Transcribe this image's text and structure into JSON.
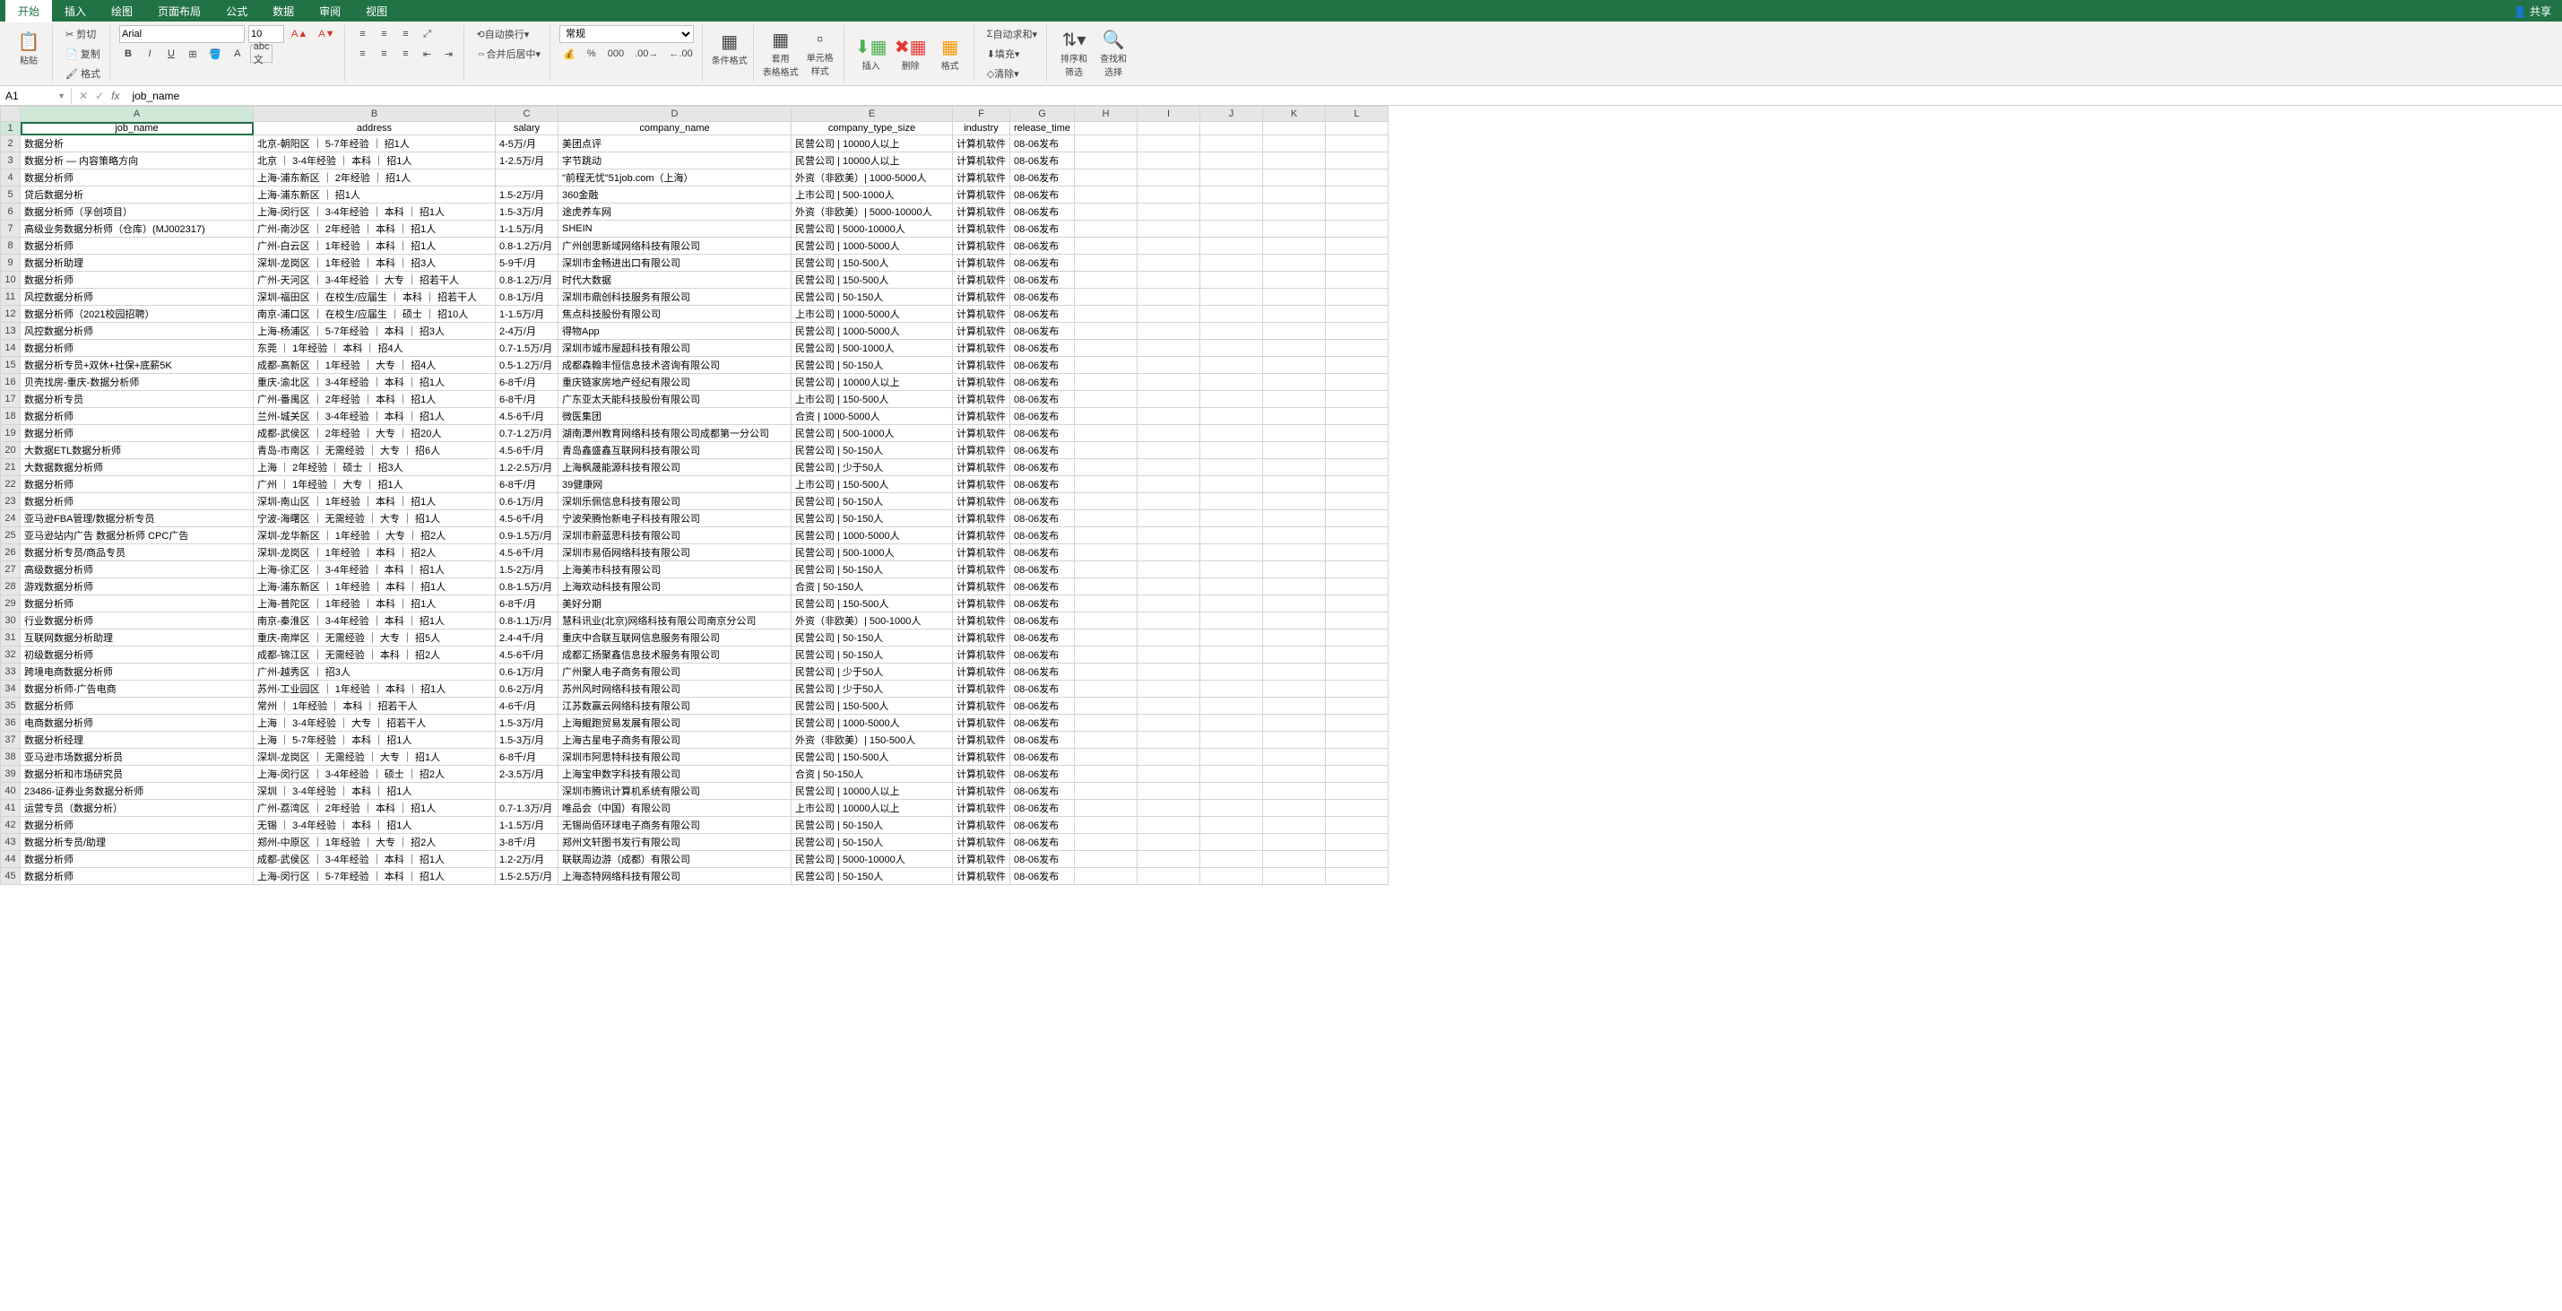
{
  "tabs": {
    "t0": "开始",
    "t1": "插入",
    "t2": "绘图",
    "t3": "页面布局",
    "t4": "公式",
    "t5": "数据",
    "t6": "审阅",
    "t7": "视图",
    "share": "共享"
  },
  "ribbon": {
    "paste_label": "粘贴",
    "cut": "剪切",
    "copy": "复制",
    "format": "格式",
    "font_name": "Arial",
    "font_size": "10",
    "wrap": "自动换行",
    "merge": "合并后居中",
    "number_format": "常规",
    "cond_fmt": "条件格式",
    "table_fmt": "套用\n表格格式",
    "cell_style": "单元格\n样式",
    "insert": "插入",
    "delete": "删除",
    "fmt": "格式",
    "autosum": "自动求和",
    "fill": "填充",
    "clear": "清除",
    "sort": "排序和\n筛选",
    "find": "查找和\n选择"
  },
  "namebox": "A1",
  "formula": "job_name",
  "cols": [
    "A",
    "B",
    "C",
    "D",
    "E",
    "F",
    "G",
    "H",
    "I",
    "J",
    "K",
    "L"
  ],
  "headers": {
    "A": "job_name",
    "B": "address",
    "C": "salary",
    "D": "company_name",
    "E": "company_type_size",
    "F": "industry",
    "G": "release_time"
  },
  "rows": [
    {
      "A": "数据分析",
      "B": "北京-朝阳区 ｜ 5-7年经验 ｜ 招1人",
      "C": "4-5万/月",
      "D": "美团点评",
      "E": "民营公司 | 10000人以上",
      "F": "计算机软件",
      "G": "08-06发布"
    },
    {
      "A": "数据分析 — 内容策略方向",
      "B": "北京 ｜ 3-4年经验 ｜ 本科 ｜ 招1人",
      "C": "1-2.5万/月",
      "D": "字节跳动",
      "E": "民营公司 | 10000人以上",
      "F": "计算机软件",
      "G": "08-06发布"
    },
    {
      "A": "数据分析师",
      "B": "上海-浦东新区 ｜ 2年经验 ｜ 招1人",
      "C": "",
      "D": "\"前程无忧\"51job.com（上海）",
      "E": "外资（非欧美）| 1000-5000人",
      "F": "计算机软件",
      "G": "08-06发布"
    },
    {
      "A": "贷后数据分析",
      "B": "上海-浦东新区 ｜ 招1人",
      "C": "1.5-2万/月",
      "D": "360金融",
      "E": "上市公司 | 500-1000人",
      "F": "计算机软件",
      "G": "08-06发布"
    },
    {
      "A": "数据分析师（孚创项目）",
      "B": "上海-闵行区 ｜ 3-4年经验 ｜ 本科 ｜ 招1人",
      "C": "1.5-3万/月",
      "D": "途虎养车网",
      "E": "外资（非欧美）| 5000-10000人",
      "F": "计算机软件",
      "G": "08-06发布"
    },
    {
      "A": "高级业务数据分析师（仓库）(MJ002317)",
      "B": "广州-南沙区 ｜ 2年经验 ｜ 本科 ｜ 招1人",
      "C": "1-1.5万/月",
      "D": "SHEIN",
      "E": "民营公司 | 5000-10000人",
      "F": "计算机软件",
      "G": "08-06发布"
    },
    {
      "A": "数据分析师",
      "B": "广州-白云区 ｜ 1年经验 ｜ 本科 ｜ 招1人",
      "C": "0.8-1.2万/月",
      "D": "广州创思新域网络科技有限公司",
      "E": "民营公司 | 1000-5000人",
      "F": "计算机软件",
      "G": "08-06发布"
    },
    {
      "A": "数据分析助理",
      "B": "深圳-龙岗区 ｜ 1年经验 ｜ 本科 ｜ 招3人",
      "C": "5-9千/月",
      "D": "深圳市金畅进出口有限公司",
      "E": "民营公司 | 150-500人",
      "F": "计算机软件",
      "G": "08-06发布"
    },
    {
      "A": "数据分析师",
      "B": "广州-天河区 ｜ 3-4年经验 ｜ 大专 ｜ 招若干人",
      "C": "0.8-1.2万/月",
      "D": "时代大数据",
      "E": "民营公司 | 150-500人",
      "F": "计算机软件",
      "G": "08-06发布"
    },
    {
      "A": "风控数据分析师",
      "B": "深圳-福田区 ｜ 在校生/应届生 ｜ 本科 ｜ 招若干人",
      "C": "0.8-1万/月",
      "D": "深圳市鼎创科技服务有限公司",
      "E": "民营公司 | 50-150人",
      "F": "计算机软件",
      "G": "08-06发布"
    },
    {
      "A": "数据分析师（2021校园招聘）",
      "B": "南京-浦口区 ｜ 在校生/应届生 ｜ 硕士 ｜ 招10人",
      "C": "1-1.5万/月",
      "D": "焦点科技股份有限公司",
      "E": "上市公司 | 1000-5000人",
      "F": "计算机软件",
      "G": "08-06发布"
    },
    {
      "A": "风控数据分析师",
      "B": "上海-杨浦区 ｜ 5-7年经验 ｜ 本科 ｜ 招3人",
      "C": "2-4万/月",
      "D": "得物App",
      "E": "民营公司 | 1000-5000人",
      "F": "计算机软件",
      "G": "08-06发布"
    },
    {
      "A": "数据分析师",
      "B": "东莞 ｜ 1年经验 ｜ 本科 ｜ 招4人",
      "C": "0.7-1.5万/月",
      "D": "深圳市城市屋超科技有限公司",
      "E": "民营公司 | 500-1000人",
      "F": "计算机软件",
      "G": "08-06发布"
    },
    {
      "A": "数据分析专员+双休+社保+底薪5K",
      "B": "成都-高新区 ｜ 1年经验 ｜ 大专 ｜ 招4人",
      "C": "0.5-1.2万/月",
      "D": "成都森翰丰恒信息技术咨询有限公司",
      "E": "民营公司 | 50-150人",
      "F": "计算机软件",
      "G": "08-06发布"
    },
    {
      "A": "贝壳找房-重庆-数据分析师",
      "B": "重庆-渝北区 ｜ 3-4年经验 ｜ 本科 ｜ 招1人",
      "C": "6-8千/月",
      "D": "重庆链家房地产经纪有限公司",
      "E": "民营公司 | 10000人以上",
      "F": "计算机软件",
      "G": "08-06发布"
    },
    {
      "A": "数据分析专员",
      "B": "广州-番禺区 ｜ 2年经验 ｜ 本科 ｜ 招1人",
      "C": "6-8千/月",
      "D": "广东亚太天能科技股份有限公司",
      "E": "上市公司 | 150-500人",
      "F": "计算机软件",
      "G": "08-06发布"
    },
    {
      "A": "数据分析师",
      "B": "兰州-城关区 ｜ 3-4年经验 ｜ 本科 ｜ 招1人",
      "C": "4.5-6千/月",
      "D": "微医集团",
      "E": "合资 | 1000-5000人",
      "F": "计算机软件",
      "G": "08-06发布"
    },
    {
      "A": "数据分析师",
      "B": "成都-武侯区 ｜ 2年经验 ｜ 大专 ｜ 招20人",
      "C": "0.7-1.2万/月",
      "D": "湖南潭州教育网络科技有限公司成都第一分公司",
      "E": "民营公司 | 500-1000人",
      "F": "计算机软件",
      "G": "08-06发布"
    },
    {
      "A": "大数据ETL数据分析师",
      "B": "青岛-市南区 ｜ 无需经验 ｜ 大专 ｜ 招6人",
      "C": "4.5-6千/月",
      "D": "青岛鑫盛鑫互联网科技有限公司",
      "E": "民营公司 | 50-150人",
      "F": "计算机软件",
      "G": "08-06发布"
    },
    {
      "A": "大数据数据分析师",
      "B": "上海 ｜ 2年经验 ｜ 硕士 ｜ 招3人",
      "C": "1.2-2.5万/月",
      "D": "上海枫晟能源科技有限公司",
      "E": "民营公司 | 少于50人",
      "F": "计算机软件",
      "G": "08-06发布"
    },
    {
      "A": "数据分析师",
      "B": "广州 ｜ 1年经验 ｜ 大专 ｜ 招1人",
      "C": "6-8千/月",
      "D": "39健康网",
      "E": "上市公司 | 150-500人",
      "F": "计算机软件",
      "G": "08-06发布"
    },
    {
      "A": "数据分析师",
      "B": "深圳-南山区 ｜ 1年经验 ｜ 本科 ｜ 招1人",
      "C": "0.6-1万/月",
      "D": "深圳乐佩信息科技有限公司",
      "E": "民营公司 | 50-150人",
      "F": "计算机软件",
      "G": "08-06发布"
    },
    {
      "A": "亚马逊FBA管理/数据分析专员",
      "B": "宁波-海曙区 ｜ 无需经验 ｜ 大专 ｜ 招1人",
      "C": "4.5-6千/月",
      "D": "宁波荣腾怡新电子科技有限公司",
      "E": "民营公司 | 50-150人",
      "F": "计算机软件",
      "G": "08-06发布"
    },
    {
      "A": "亚马逊站内广告 数据分析师  CPC广告",
      "B": "深圳-龙华新区 ｜ 1年经验 ｜ 大专 ｜ 招2人",
      "C": "0.9-1.5万/月",
      "D": "深圳市蔚蓝思科技有限公司",
      "E": "民营公司 | 1000-5000人",
      "F": "计算机软件",
      "G": "08-06发布"
    },
    {
      "A": "数据分析专员/商品专员",
      "B": "深圳-龙岗区 ｜ 1年经验 ｜ 本科 ｜ 招2人",
      "C": "4.5-6千/月",
      "D": "深圳市易佰网络科技有限公司",
      "E": "民营公司 | 500-1000人",
      "F": "计算机软件",
      "G": "08-06发布"
    },
    {
      "A": "高级数据分析师",
      "B": "上海-徐汇区 ｜ 3-4年经验 ｜ 本科 ｜ 招1人",
      "C": "1.5-2万/月",
      "D": "上海美市科技有限公司",
      "E": "民营公司 | 50-150人",
      "F": "计算机软件",
      "G": "08-06发布"
    },
    {
      "A": "游戏数据分析师",
      "B": "上海-浦东新区 ｜ 1年经验 ｜ 本科 ｜ 招1人",
      "C": "0.8-1.5万/月",
      "D": "上海欢动科技有限公司",
      "E": "合资 | 50-150人",
      "F": "计算机软件",
      "G": "08-06发布"
    },
    {
      "A": "数据分析师",
      "B": "上海-普陀区 ｜ 1年经验 ｜ 本科 ｜ 招1人",
      "C": "6-8千/月",
      "D": "美好分期",
      "E": "民营公司 | 150-500人",
      "F": "计算机软件",
      "G": "08-06发布"
    },
    {
      "A": "行业数据分析师",
      "B": "南京-秦淮区 ｜ 3-4年经验 ｜ 本科 ｜ 招1人",
      "C": "0.8-1.1万/月",
      "D": "慧科讯业(北京)网络科技有限公司南京分公司",
      "E": "外资（非欧美）| 500-1000人",
      "F": "计算机软件",
      "G": "08-06发布"
    },
    {
      "A": "互联网数据分析助理",
      "B": "重庆-南岸区 ｜ 无需经验 ｜ 大专 ｜ 招5人",
      "C": "2.4-4千/月",
      "D": "重庆中合联互联网信息服务有限公司",
      "E": "民营公司 | 50-150人",
      "F": "计算机软件",
      "G": "08-06发布"
    },
    {
      "A": "初级数据分析师",
      "B": "成都-锦江区 ｜ 无需经验 ｜ 本科 ｜ 招2人",
      "C": "4.5-6千/月",
      "D": "成都汇扬聚鑫信息技术服务有限公司",
      "E": "民营公司 | 50-150人",
      "F": "计算机软件",
      "G": "08-06发布"
    },
    {
      "A": "跨境电商数据分析师",
      "B": "广州-越秀区 ｜ 招3人",
      "C": "0.6-1万/月",
      "D": "广州聚人电子商务有限公司",
      "E": "民营公司 | 少于50人",
      "F": "计算机软件",
      "G": "08-06发布"
    },
    {
      "A": "数据分析师-广告电商",
      "B": "苏州-工业园区 ｜ 1年经验 ｜ 本科 ｜ 招1人",
      "C": "0.6-2万/月",
      "D": "苏州风时网络科技有限公司",
      "E": "民营公司 | 少于50人",
      "F": "计算机软件",
      "G": "08-06发布"
    },
    {
      "A": "数据分析师",
      "B": "常州 ｜ 1年经验 ｜ 本科 ｜ 招若干人",
      "C": "4-6千/月",
      "D": "江苏数赢云网络科技有限公司",
      "E": "民营公司 | 150-500人",
      "F": "计算机软件",
      "G": "08-06发布"
    },
    {
      "A": "电商数据分析师",
      "B": "上海 ｜ 3-4年经验 ｜ 大专 ｜ 招若干人",
      "C": "1.5-3万/月",
      "D": "上海鲲跑贸易发展有限公司",
      "E": "民营公司 | 1000-5000人",
      "F": "计算机软件",
      "G": "08-06发布"
    },
    {
      "A": "数据分析经理",
      "B": "上海 ｜ 5-7年经验 ｜ 本科 ｜ 招1人",
      "C": "1.5-3万/月",
      "D": "上海古星电子商务有限公司",
      "E": "外资（非欧美）| 150-500人",
      "F": "计算机软件",
      "G": "08-06发布"
    },
    {
      "A": "亚马逊市场数据分析员",
      "B": "深圳-龙岗区 ｜ 无需经验 ｜ 大专 ｜ 招1人",
      "C": "6-8千/月",
      "D": "深圳市阿思特科技有限公司",
      "E": "民营公司 | 150-500人",
      "F": "计算机软件",
      "G": "08-06发布"
    },
    {
      "A": "数据分析和市场研究员",
      "B": "上海-闵行区 ｜ 3-4年经验 ｜ 硕士 ｜ 招2人",
      "C": "2-3.5万/月",
      "D": "上海宝申数字科技有限公司",
      "E": "合资 | 50-150人",
      "F": "计算机软件",
      "G": "08-06发布"
    },
    {
      "A": "23486-证券业务数据分析师",
      "B": "深圳 ｜ 3-4年经验 ｜ 本科 ｜ 招1人",
      "C": "",
      "D": "深圳市腾讯计算机系统有限公司",
      "E": "民营公司 | 10000人以上",
      "F": "计算机软件",
      "G": "08-06发布"
    },
    {
      "A": "运营专员（数据分析）",
      "B": "广州-荔湾区 ｜ 2年经验 ｜ 本科 ｜ 招1人",
      "C": "0.7-1.3万/月",
      "D": "唯品会（中国）有限公司",
      "E": "上市公司 | 10000人以上",
      "F": "计算机软件",
      "G": "08-06发布"
    },
    {
      "A": "数据分析师",
      "B": "无锡 ｜ 3-4年经验 ｜ 本科 ｜ 招1人",
      "C": "1-1.5万/月",
      "D": "无锡尚佰环球电子商务有限公司",
      "E": "民营公司 | 50-150人",
      "F": "计算机软件",
      "G": "08-06发布"
    },
    {
      "A": "数据分析专员/助理",
      "B": "郑州-中原区 ｜ 1年经验 ｜ 大专 ｜ 招2人",
      "C": "3-8千/月",
      "D": "郑州文轩图书发行有限公司",
      "E": "民营公司 | 50-150人",
      "F": "计算机软件",
      "G": "08-06发布"
    },
    {
      "A": "数据分析师",
      "B": "成都-武侯区 ｜ 3-4年经验 ｜ 本科 ｜ 招1人",
      "C": "1.2-2万/月",
      "D": "联联周边游（成都）有限公司",
      "E": "民营公司 | 5000-10000人",
      "F": "计算机软件",
      "G": "08-06发布"
    },
    {
      "A": "数据分析师",
      "B": "上海-闵行区 ｜ 5-7年经验 ｜ 本科 ｜ 招1人",
      "C": "1.5-2.5万/月",
      "D": "上海态特网络科技有限公司",
      "E": "民营公司 | 50-150人",
      "F": "计算机软件",
      "G": "08-06发布"
    }
  ]
}
